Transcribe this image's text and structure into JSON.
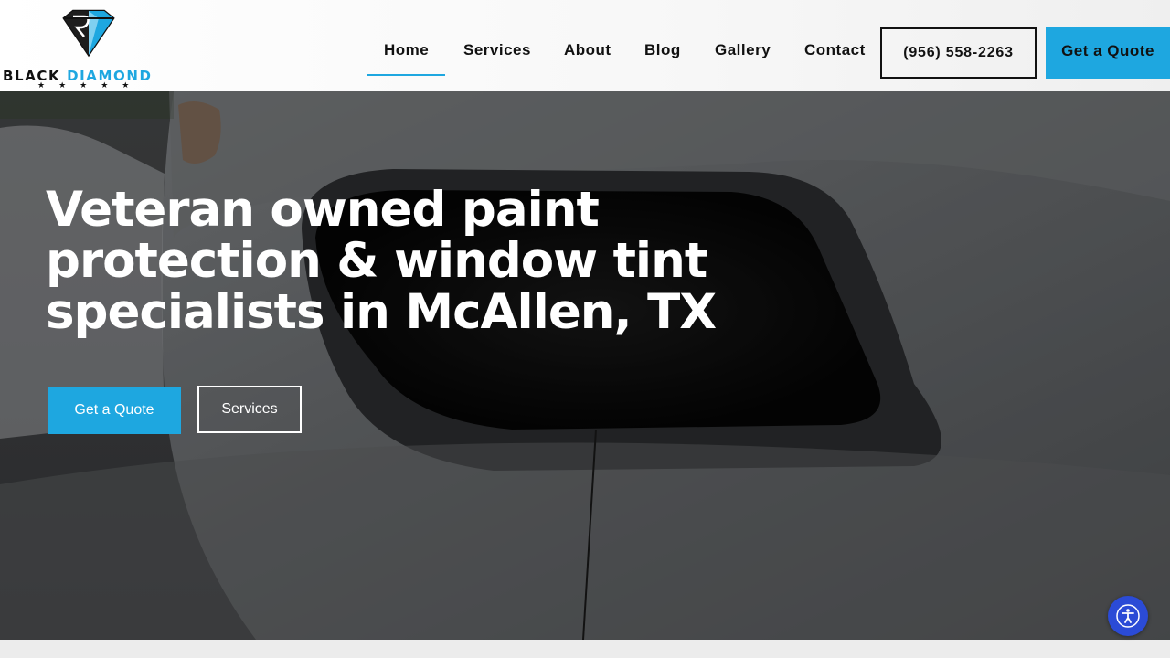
{
  "brand": {
    "word_black": "BLACK",
    "word_blue": "DIAMOND",
    "stars": "★★★★★",
    "colors": {
      "accent": "#1ea7e0",
      "dark": "#111111"
    }
  },
  "nav": {
    "items": [
      {
        "label": "Home",
        "active": true
      },
      {
        "label": "Services",
        "active": false
      },
      {
        "label": "About",
        "active": false
      },
      {
        "label": "Blog",
        "active": false
      },
      {
        "label": "Gallery",
        "active": false
      },
      {
        "label": "Contact",
        "active": false
      }
    ],
    "phone": "(956) 558-2263",
    "quote_label": "Get a Quote"
  },
  "hero": {
    "title_line1": "Veteran owned paint",
    "title_line2": "protection & window tint",
    "title_line3": "specialists in McAllen, TX",
    "primary_cta": "Get a Quote",
    "secondary_cta": "Services"
  },
  "accessibility": {
    "icon": "accessibility-icon",
    "color": "#2b4bd6"
  }
}
